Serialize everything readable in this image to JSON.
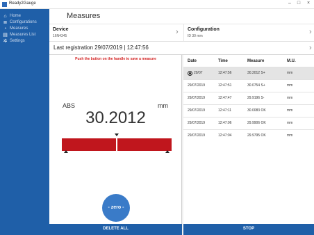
{
  "window": {
    "title": "Ready2Gauge",
    "minimize": "–",
    "maximize": "□",
    "close": "×"
  },
  "sidebar": {
    "items": [
      {
        "label": "Home",
        "icon": "home-icon",
        "glyph": "⌂"
      },
      {
        "label": "Configurations",
        "icon": "configurations-icon",
        "glyph": "≣"
      },
      {
        "label": "Measures",
        "icon": "measures-icon",
        "glyph": "◔"
      },
      {
        "label": "Measures List",
        "icon": "list-icon",
        "glyph": "▤"
      },
      {
        "label": "Settings",
        "icon": "gear-icon",
        "glyph": "✲"
      }
    ]
  },
  "header": {
    "title": "Measures"
  },
  "device": {
    "title": "Device",
    "sub": "16N4345",
    "chevron": "›"
  },
  "configuration": {
    "title": "Configuration",
    "sub": "ID 30 mm",
    "chevron": "›"
  },
  "last_registration": {
    "text": "Last registration  29/07/2019 | 12:47:56",
    "chevron": "›"
  },
  "measure": {
    "instruction": "Push the button on the handle to save a measure",
    "mode": "ABS",
    "unit": "mm",
    "value": "30.2012",
    "zero_label": "- zero -"
  },
  "table": {
    "headers": [
      "Date",
      "Time",
      "Measure",
      "M.U."
    ],
    "rows": [
      {
        "date": "29/07",
        "time": "12:47:56",
        "measure": "30.2012 S+",
        "mu": "mm",
        "selected": true
      },
      {
        "date": "29/07/2019",
        "time": "12:47:51",
        "measure": "30.0754 S+",
        "mu": "mm"
      },
      {
        "date": "29/07/2019",
        "time": "12:47:47",
        "measure": "29.9196 S-",
        "mu": "mm"
      },
      {
        "date": "29/07/2019",
        "time": "12:47:11",
        "measure": "30.0083 OK",
        "mu": "mm"
      },
      {
        "date": "29/07/2019",
        "time": "12:47:06",
        "measure": "29.9906 OK",
        "mu": "mm"
      },
      {
        "date": "29/07/2019",
        "time": "12:47:04",
        "measure": "29.9795 OK",
        "mu": "mm"
      }
    ]
  },
  "actions": {
    "delete_all": "DELETE ALL",
    "stop": "STOP"
  },
  "colors": {
    "accent": "#1f5fa8",
    "gauge_bar": "#c0161d",
    "warning_text": "#d21f1f",
    "zero_button": "#3a7bc8"
  }
}
